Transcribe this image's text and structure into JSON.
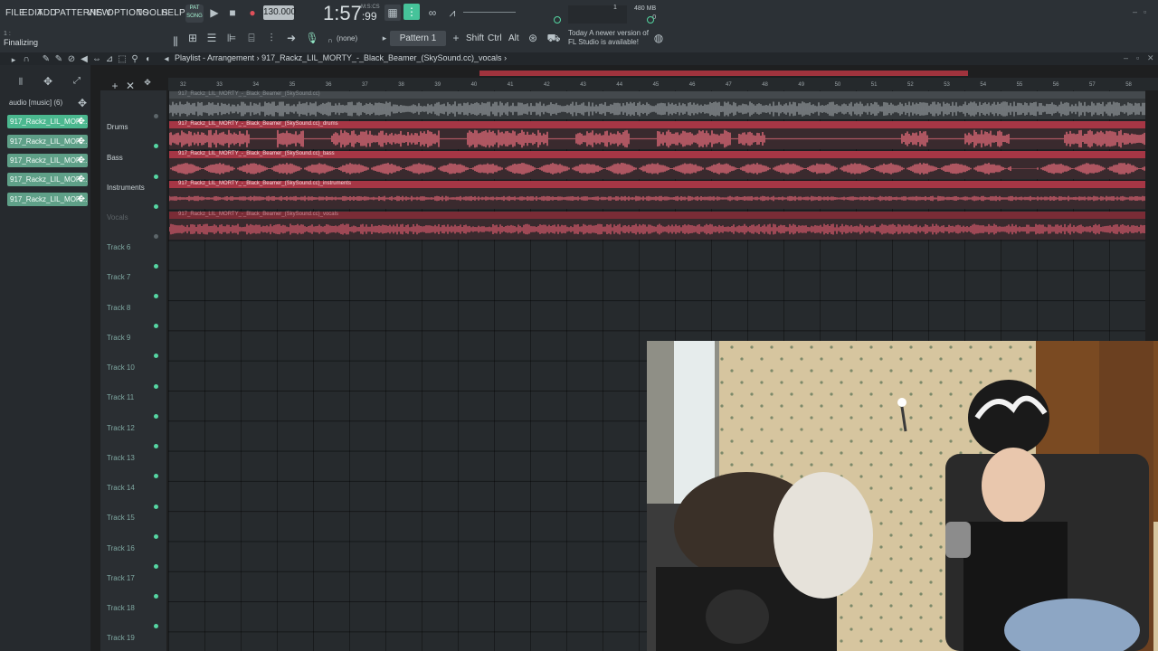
{
  "menu": [
    "FILE",
    "EDIT",
    "ADD",
    "PATTERNS",
    "VIEW",
    "OPTIONS",
    "TOOLS",
    "HELP"
  ],
  "transport": {
    "song_mode_label": "SONG",
    "pat_label": "PAT",
    "tempo": "130.000",
    "time": "1:57",
    "time_fraction": ":99",
    "time_unit": "M:S:CS"
  },
  "status": {
    "text": "Finalizing",
    "sub": "1 :"
  },
  "toolbar": {
    "pattern_none": "(none)",
    "pattern": "Pattern 1",
    "shift": "Shift",
    "ctrl": "Ctrl",
    "alt": "Alt",
    "news_line1": "Today  A newer version of",
    "news_line2": "FL Studio is available!",
    "memory": "480 MB",
    "memory_count": "0",
    "cpu_count": "1"
  },
  "playlist": {
    "title": "Playlist - Arrangement",
    "breadcrumb": "917_Rackz_LIL_MORTY_-_Black_Beamer_(SkySound.cc)_vocals",
    "breadcrumb_arrow": "›"
  },
  "browser": {
    "title": "audio [music] (6)",
    "items": [
      "917_Rackz_LIL_MOR...",
      "917_Rackz_LIL_MOR...",
      "917_Rackz_LIL_MOR...",
      "917_Rackz_LIL_MOR...",
      "917_Rackz_LIL_MOR..."
    ]
  },
  "ruler_ticks": [
    "32",
    "33",
    "34",
    "35",
    "36",
    "37",
    "38",
    "39",
    "40",
    "41",
    "42",
    "43",
    "44",
    "45",
    "46",
    "47",
    "48",
    "49",
    "50",
    "51",
    "52",
    "53",
    "54",
    "55",
    "56",
    "57",
    "58"
  ],
  "tracks": [
    {
      "name": "",
      "clip": "917_Rackz_LIL_MORTY_-_Black_Beamer_(SkySound.cc)"
    },
    {
      "name": "Drums",
      "clip": "917_Rackz_LIL_MORTY_-_Black_Beamer_(SkySound.cc)_drums"
    },
    {
      "name": "Bass",
      "clip": "917_Rackz_LIL_MORTY_-_Black_Beamer_(SkySound.cc)_bass"
    },
    {
      "name": "Instruments",
      "clip": "917_Rackz_LIL_MORTY_-_Black_Beamer_(SkySound.cc)_instruments"
    },
    {
      "name": "Vocals",
      "clip": "917_Rackz_LIL_MORTY_-_Black_Beamer_(SkySound.cc)_vocals"
    }
  ],
  "empty_tracks": [
    "Track 6",
    "Track 7",
    "Track 8",
    "Track 9",
    "Track 10",
    "Track 11",
    "Track 12",
    "Track 13",
    "Track 14",
    "Track 15",
    "Track 16",
    "Track 17",
    "Track 18",
    "Track 19"
  ],
  "colors": {
    "accent": "#4bb88f",
    "clip_red": "#a63645",
    "wave_pink": "#e06a78"
  },
  "icons": [
    "play-icon",
    "stop-icon",
    "record-icon",
    "pencil-icon",
    "magnet-icon",
    "zoom-icon",
    "speaker-icon",
    "plus-icon",
    "close-icon"
  ]
}
